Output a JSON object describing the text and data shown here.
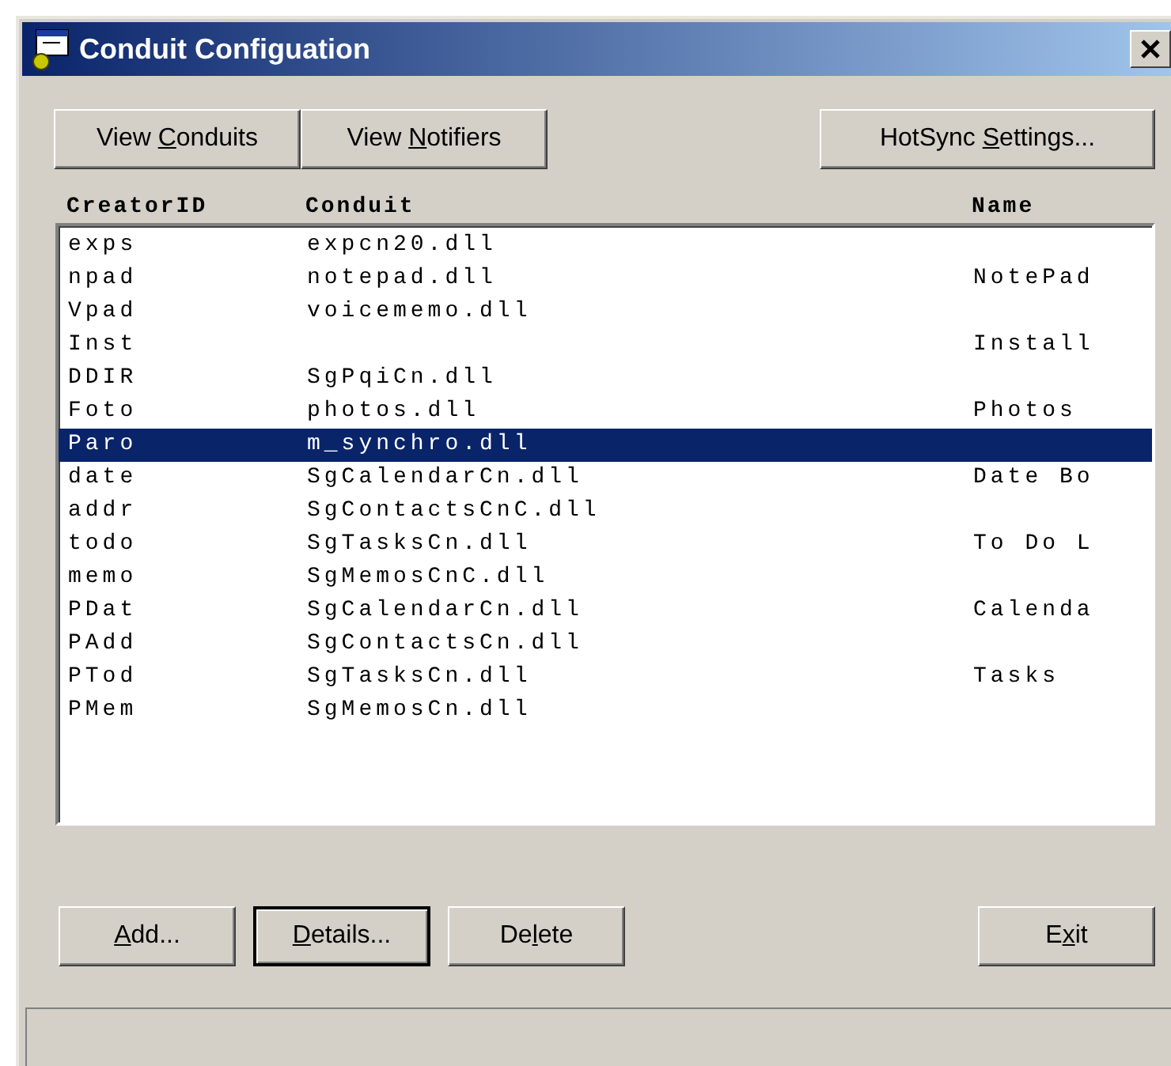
{
  "window": {
    "title": "Conduit Configuation"
  },
  "top_buttons": [
    {
      "pre": "View ",
      "key": "C",
      "post": "onduits"
    },
    {
      "pre": "View ",
      "key": "N",
      "post": "otifiers"
    }
  ],
  "settings_button": {
    "pre": "HotSync ",
    "key": "S",
    "post": "ettings..."
  },
  "table": {
    "columns": [
      "CreatorID",
      "Conduit",
      "Name"
    ],
    "rows": [
      {
        "cells": [
          "exps",
          "expcn20.dll",
          ""
        ],
        "selected": false
      },
      {
        "cells": [
          "npad",
          "notepad.dll",
          "NotePad"
        ],
        "selected": false
      },
      {
        "cells": [
          "Vpad",
          "voicememo.dll",
          ""
        ],
        "selected": false
      },
      {
        "cells": [
          "Inst",
          "",
          "Install"
        ],
        "selected": false
      },
      {
        "cells": [
          "DDIR",
          "SgPqiCn.dll",
          ""
        ],
        "selected": false
      },
      {
        "cells": [
          "Foto",
          "photos.dll",
          "Photos"
        ],
        "selected": false
      },
      {
        "cells": [
          "Paro",
          "m_synchro.dll",
          ""
        ],
        "selected": true
      },
      {
        "cells": [
          "date",
          "SgCalendarCn.dll",
          "Date Bo"
        ],
        "selected": false
      },
      {
        "cells": [
          "addr",
          "SgContactsCnC.dll",
          ""
        ],
        "selected": false
      },
      {
        "cells": [
          "todo",
          "SgTasksCn.dll",
          "To Do L"
        ],
        "selected": false
      },
      {
        "cells": [
          "memo",
          "SgMemosCnC.dll",
          ""
        ],
        "selected": false
      },
      {
        "cells": [
          "PDat",
          "SgCalendarCn.dll",
          "Calenda"
        ],
        "selected": false
      },
      {
        "cells": [
          "PAdd",
          "SgContactsCn.dll",
          ""
        ],
        "selected": false
      },
      {
        "cells": [
          "PTod",
          "SgTasksCn.dll",
          "Tasks"
        ],
        "selected": false
      },
      {
        "cells": [
          "PMem",
          "SgMemosCn.dll",
          ""
        ],
        "selected": false
      }
    ]
  },
  "bottom_buttons": [
    {
      "key": "A",
      "post": "dd...",
      "default": false
    },
    {
      "key": "D",
      "post": "etails...",
      "default": true
    },
    {
      "pre": "De",
      "key": "l",
      "post": "ete",
      "default": false
    }
  ],
  "exit_button": {
    "pre": "E",
    "key": "x",
    "post": "it"
  }
}
